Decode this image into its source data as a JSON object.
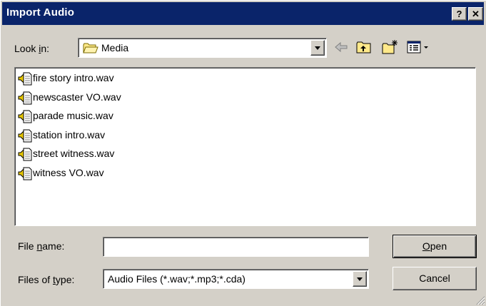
{
  "window": {
    "title": "Import Audio",
    "help_glyph": "?",
    "close_glyph": "✕"
  },
  "lookin": {
    "label_prefix": "Look ",
    "label_accel": "i",
    "label_suffix": "n:",
    "value": "Media"
  },
  "toolbar": {
    "icons": [
      "back-arrow-icon",
      "up-folder-icon",
      "new-folder-icon",
      "view-menu-icon"
    ]
  },
  "files": [
    {
      "name": "fire story intro.wav"
    },
    {
      "name": "newscaster VO.wav"
    },
    {
      "name": "parade music.wav"
    },
    {
      "name": "station intro.wav"
    },
    {
      "name": "street witness.wav"
    },
    {
      "name": "witness VO.wav"
    }
  ],
  "filename": {
    "label_prefix": "File ",
    "label_accel": "n",
    "label_suffix": "ame:",
    "value": ""
  },
  "filetype": {
    "label_prefix": "Files of ",
    "label_accel": "t",
    "label_suffix": "ype:",
    "value": "Audio Files (*.wav;*.mp3;*.cda)"
  },
  "buttons": {
    "open_accel": "O",
    "open_rest": "pen",
    "cancel": "Cancel"
  },
  "colors": {
    "titlebar": "#0a246a",
    "face": "#d4d0c8"
  }
}
